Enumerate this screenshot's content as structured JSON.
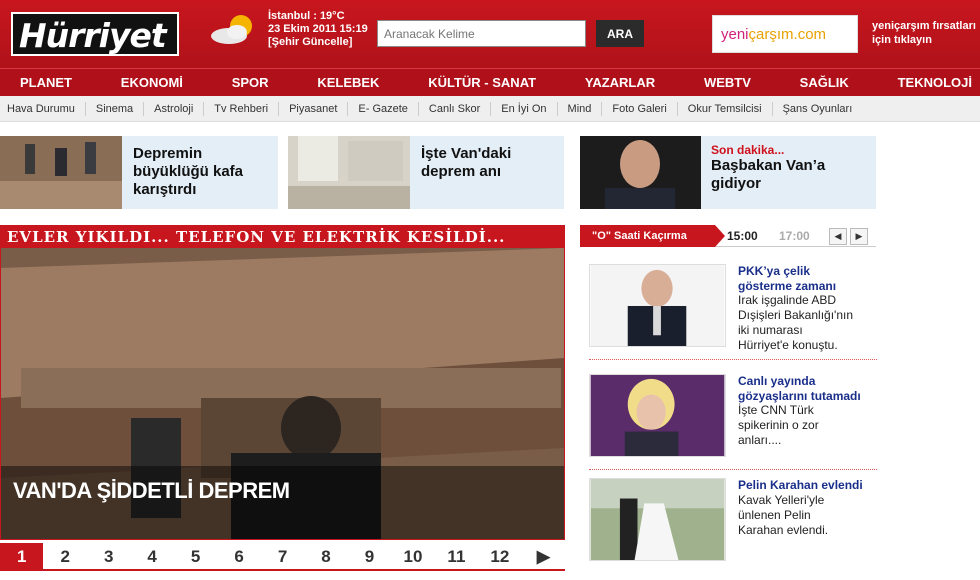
{
  "header": {
    "logo": "Hürriyet",
    "weather_line1": "İstanbul : 19°C",
    "weather_line2": "23 Ekim 2011 15:19",
    "weather_line3": "[Şehir Güncelle]",
    "search_placeholder": "Aranacak Kelime",
    "search_button": "ARA",
    "ad_logo_prefix": "yeni",
    "ad_logo_rest": "çarşım.com",
    "ad_text_line1": "yeniçarşım fırsatları",
    "ad_text_line2": "için tıklayın"
  },
  "nav": [
    "PLANET",
    "EKONOMİ",
    "SPOR",
    "KELEBEK",
    "KÜLTÜR - SANAT",
    "YAZARLAR",
    "WEBTV",
    "SAĞLIK",
    "TEKNOLOJİ"
  ],
  "subnav": [
    "Hava Durumu",
    "Sinema",
    "Astroloji",
    "Tv Rehberi",
    "Piyasanet",
    "E- Gazete",
    "Canlı Skor",
    "En İyi On",
    "Mind",
    "Foto Galeri",
    "Okur Temsilcisi",
    "Şans Oyunları"
  ],
  "top_stories": [
    {
      "title_line1": "Depremin",
      "title_line2": "büyüklüğü kafa",
      "title_line3": "karıştırdı"
    },
    {
      "title_line1": "İşte Van'daki",
      "title_line2": "deprem anı"
    },
    {
      "kicker": "Son dakika...",
      "title_line1": "Başbakan Van’a",
      "title_line2": "gidiyor"
    }
  ],
  "main": {
    "banner": "EVLER YIKILDI... TELEFON VE ELEKTRİK KESİLDİ...",
    "headline": "VAN'DA ŞİDDETLİ DEPREM",
    "pages": [
      "1",
      "2",
      "3",
      "4",
      "5",
      "6",
      "7",
      "8",
      "9",
      "10",
      "11",
      "12"
    ],
    "next": "▶"
  },
  "right": {
    "tab": "\"O\" Saati Kaçırma",
    "time_active": "15:00",
    "time_next": "17:00",
    "prev": "◀",
    "next": "▶",
    "news": [
      {
        "title_line1": "PKK’ya çelik",
        "title_line2": "gösterme zamanı",
        "desc": [
          "Irak işgalinde ABD",
          "Dışişleri Bakanlığı'nın",
          "iki numarası",
          "Hürriyet'e konuştu."
        ]
      },
      {
        "title_line1": "Canlı yayında",
        "title_line2": "gözyaşlarını tutamadı",
        "desc": [
          "İşte CNN Türk",
          "spikerinin o zor",
          "anları...."
        ]
      },
      {
        "title_line1": "Pelin Karahan evlendi",
        "desc": [
          "Kavak Yelleri'yle",
          "ünlenen Pelin",
          "Karahan evlendi."
        ]
      }
    ]
  }
}
